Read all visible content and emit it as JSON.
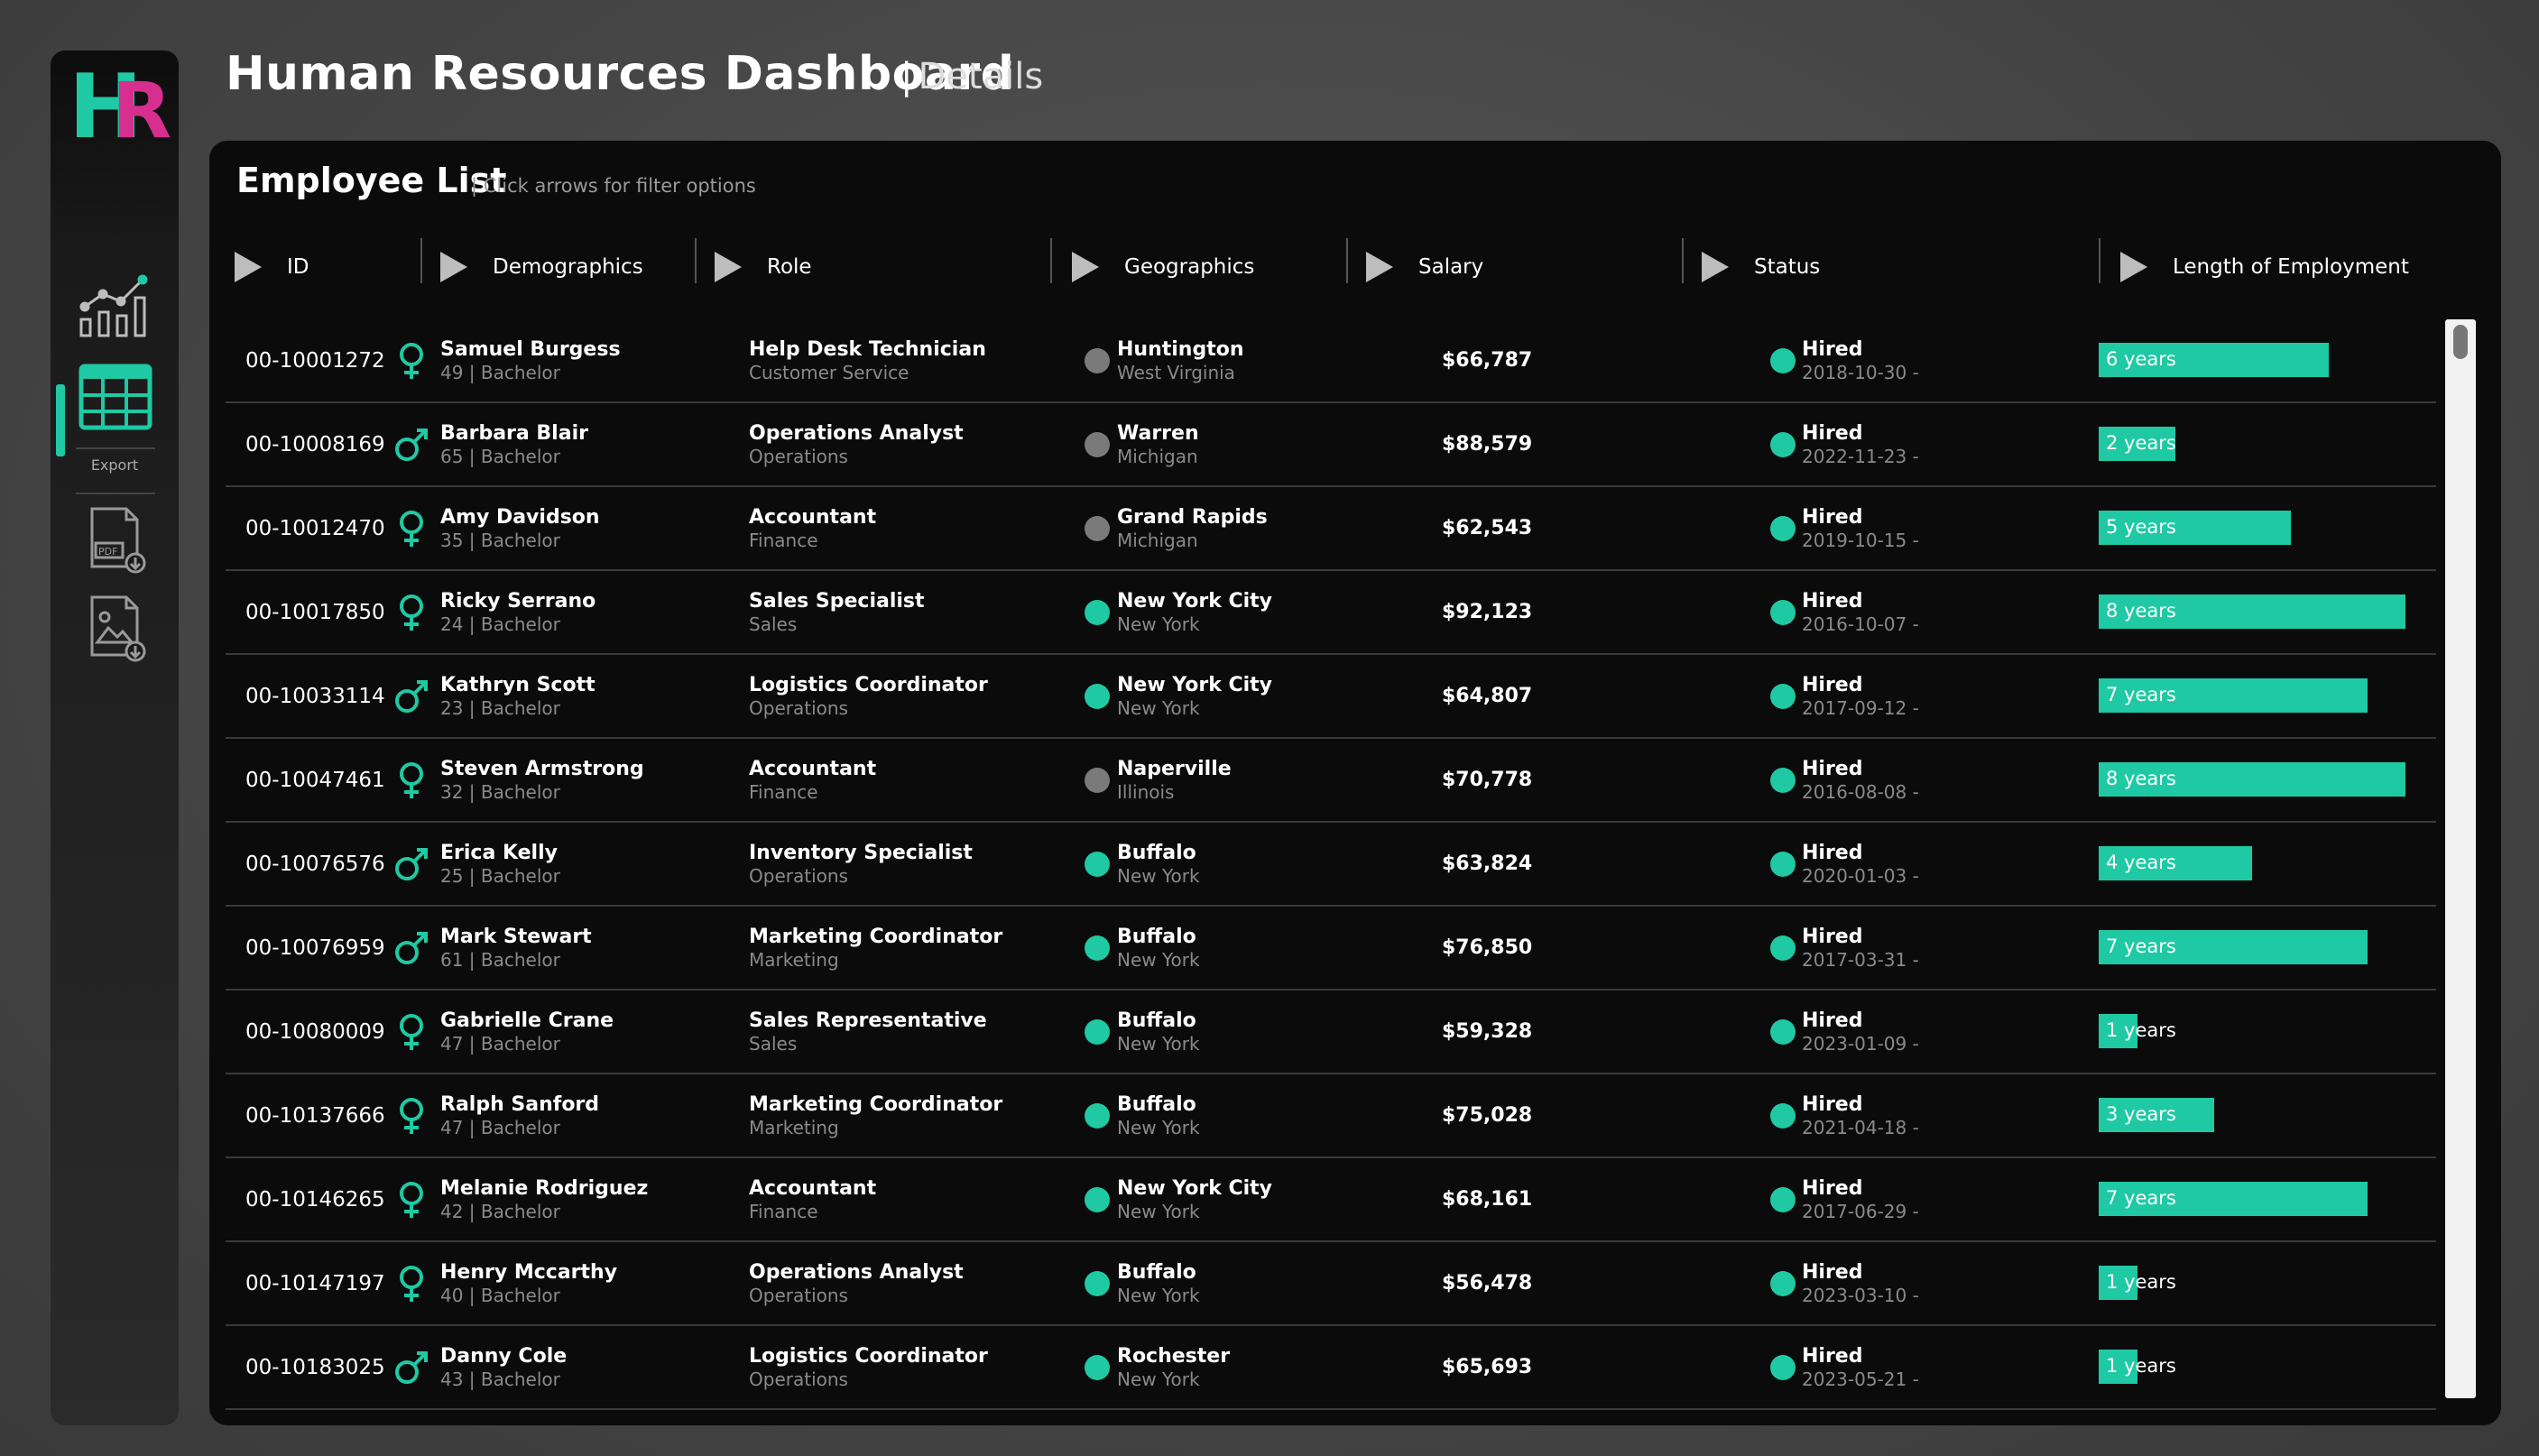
{
  "header": {
    "title": "Human Resources Dashboard",
    "subtitle": "Details"
  },
  "sidebar": {
    "logo": "HR",
    "export_label": "Export"
  },
  "panel": {
    "title": "Employee List",
    "hint": "| Click arrows for filter options"
  },
  "columns": [
    "ID",
    "Demographics",
    "Role",
    "Geographics",
    "Salary",
    "Status",
    "Length of Employment"
  ],
  "colors": {
    "accent": "#1fc9a3",
    "magenta": "#d62f8f",
    "grey_dot": "#7a7a7a"
  },
  "employees": [
    {
      "id": "00-10001272",
      "gender": "female",
      "name": "Samuel Burgess",
      "demo": "49 | Bachelor",
      "title": "Help Desk Technician",
      "dept": "Customer Service",
      "city": "Huntington",
      "state": "West Virginia",
      "geo_color": "grey",
      "salary": "$66,787",
      "status": "Hired",
      "date": "2018-10-30 -",
      "years_label": "6 years",
      "years": 6
    },
    {
      "id": "00-10008169",
      "gender": "male",
      "name": "Barbara Blair",
      "demo": "65 | Bachelor",
      "title": "Operations Analyst",
      "dept": "Operations",
      "city": "Warren",
      "state": "Michigan",
      "geo_color": "grey",
      "salary": "$88,579",
      "status": "Hired",
      "date": "2022-11-23 -",
      "years_label": "2 years",
      "years": 2
    },
    {
      "id": "00-10012470",
      "gender": "female",
      "name": "Amy Davidson",
      "demo": "35 | Bachelor",
      "title": "Accountant",
      "dept": "Finance",
      "city": "Grand Rapids",
      "state": "Michigan",
      "geo_color": "grey",
      "salary": "$62,543",
      "status": "Hired",
      "date": "2019-10-15 -",
      "years_label": "5 years",
      "years": 5
    },
    {
      "id": "00-10017850",
      "gender": "female",
      "name": "Ricky Serrano",
      "demo": "24 | Bachelor",
      "title": "Sales Specialist",
      "dept": "Sales",
      "city": "New York City",
      "state": "New York",
      "geo_color": "green",
      "salary": "$92,123",
      "status": "Hired",
      "date": "2016-10-07 -",
      "years_label": "8 years",
      "years": 8
    },
    {
      "id": "00-10033114",
      "gender": "male",
      "name": "Kathryn Scott",
      "demo": "23 | Bachelor",
      "title": "Logistics Coordinator",
      "dept": "Operations",
      "city": "New York City",
      "state": "New York",
      "geo_color": "green",
      "salary": "$64,807",
      "status": "Hired",
      "date": "2017-09-12 -",
      "years_label": "7 years",
      "years": 7
    },
    {
      "id": "00-10047461",
      "gender": "female",
      "name": "Steven Armstrong",
      "demo": "32 | Bachelor",
      "title": "Accountant",
      "dept": "Finance",
      "city": "Naperville",
      "state": "Illinois",
      "geo_color": "grey",
      "salary": "$70,778",
      "status": "Hired",
      "date": "2016-08-08 -",
      "years_label": "8 years",
      "years": 8
    },
    {
      "id": "00-10076576",
      "gender": "male",
      "name": "Erica Kelly",
      "demo": "25 | Bachelor",
      "title": "Inventory Specialist",
      "dept": "Operations",
      "city": "Buffalo",
      "state": "New York",
      "geo_color": "green",
      "salary": "$63,824",
      "status": "Hired",
      "date": "2020-01-03 -",
      "years_label": "4 years",
      "years": 4
    },
    {
      "id": "00-10076959",
      "gender": "male",
      "name": "Mark Stewart",
      "demo": "61 | Bachelor",
      "title": "Marketing Coordinator",
      "dept": "Marketing",
      "city": "Buffalo",
      "state": "New York",
      "geo_color": "green",
      "salary": "$76,850",
      "status": "Hired",
      "date": "2017-03-31 -",
      "years_label": "7 years",
      "years": 7
    },
    {
      "id": "00-10080009",
      "gender": "female",
      "name": "Gabrielle Crane",
      "demo": "47 | Bachelor",
      "title": "Sales Representative",
      "dept": "Sales",
      "city": "Buffalo",
      "state": "New York",
      "geo_color": "green",
      "salary": "$59,328",
      "status": "Hired",
      "date": "2023-01-09 -",
      "years_label": "1 years",
      "years": 1
    },
    {
      "id": "00-10137666",
      "gender": "female",
      "name": "Ralph Sanford",
      "demo": "47 | Bachelor",
      "title": "Marketing Coordinator",
      "dept": "Marketing",
      "city": "Buffalo",
      "state": "New York",
      "geo_color": "green",
      "salary": "$75,028",
      "status": "Hired",
      "date": "2021-04-18 -",
      "years_label": "3 years",
      "years": 3
    },
    {
      "id": "00-10146265",
      "gender": "female",
      "name": "Melanie Rodriguez",
      "demo": "42 | Bachelor",
      "title": "Accountant",
      "dept": "Finance",
      "city": "New York City",
      "state": "New York",
      "geo_color": "green",
      "salary": "$68,161",
      "status": "Hired",
      "date": "2017-06-29 -",
      "years_label": "7 years",
      "years": 7
    },
    {
      "id": "00-10147197",
      "gender": "female",
      "name": "Henry Mccarthy",
      "demo": "40 | Bachelor",
      "title": "Operations Analyst",
      "dept": "Operations",
      "city": "Buffalo",
      "state": "New York",
      "geo_color": "green",
      "salary": "$56,478",
      "status": "Hired",
      "date": "2023-03-10 -",
      "years_label": "1 years",
      "years": 1
    },
    {
      "id": "00-10183025",
      "gender": "male",
      "name": "Danny Cole",
      "demo": "43 | Bachelor",
      "title": "Logistics Coordinator",
      "dept": "Operations",
      "city": "Rochester",
      "state": "New York",
      "geo_color": "green",
      "salary": "$65,693",
      "status": "Hired",
      "date": "2023-05-21 -",
      "years_label": "1 years",
      "years": 1
    }
  ]
}
